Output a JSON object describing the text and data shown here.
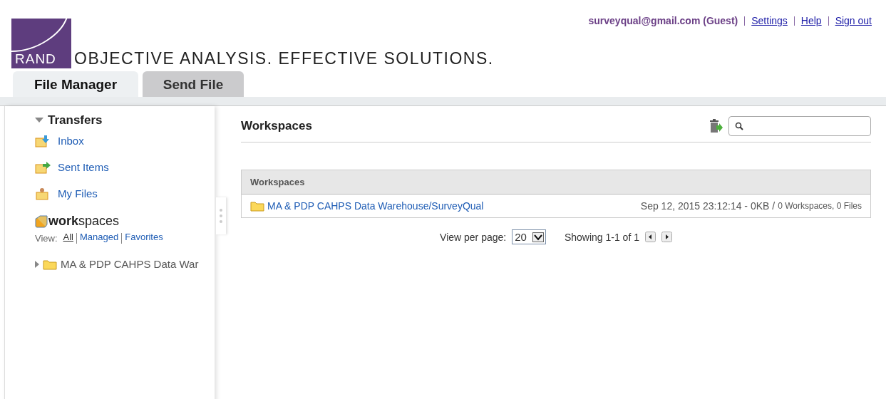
{
  "user_bar": {
    "user": "surveyqual@gmail.com (Guest)",
    "links": [
      "Settings",
      "Help",
      "Sign out"
    ]
  },
  "logo": {
    "text": "RAND",
    "tagline": "OBJECTIVE ANALYSIS. EFFECTIVE SOLUTIONS."
  },
  "tabs": [
    {
      "label": "File Manager",
      "selected": true
    },
    {
      "label": "Send File",
      "selected": false
    }
  ],
  "sidebar": {
    "transfers": {
      "title": "Transfers",
      "expanded": true,
      "items": [
        {
          "label": "Inbox",
          "kind": "inbox"
        },
        {
          "label": "Sent Items",
          "kind": "sent"
        },
        {
          "label": "My Files",
          "kind": "myfiles"
        }
      ]
    },
    "workspaces": {
      "title": "**work**spaces",
      "view_label": "View:",
      "views": [
        {
          "label": "All",
          "selected": true
        },
        {
          "label": "Managed",
          "selected": false
        },
        {
          "label": "Favorites",
          "selected": false
        }
      ],
      "tree": [
        {
          "label": "MA & PDP CAHPS Data War",
          "expanded": false
        }
      ]
    }
  },
  "main": {
    "title": "Workspaces",
    "table": {
      "header": "Workspaces",
      "rows": [
        {
          "name": "MA & PDP CAHPS Data Warehouse/SurveyQual",
          "meta": "Sep 12, 2015 23:12:14 - 0KB /",
          "counts": "0 Workspaces, 0 Files"
        }
      ]
    },
    "pager": {
      "view_label": "View per page:",
      "per_page": "20",
      "showing": "Showing 1-1 of 1"
    }
  }
}
